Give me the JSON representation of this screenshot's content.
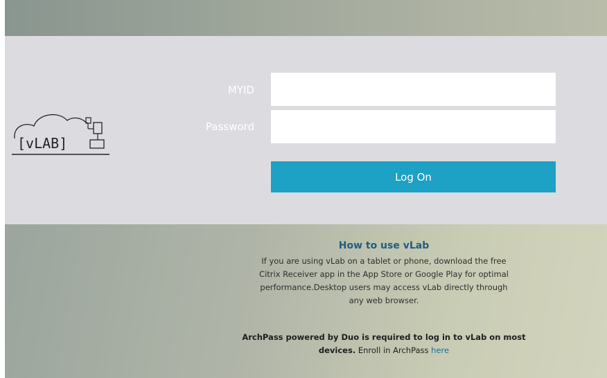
{
  "login": {
    "myid_label": "MYID",
    "myid_value": "",
    "password_label": "Password",
    "password_value": "",
    "logon_label": "Log On"
  },
  "logo": {
    "text": "[vLAB]",
    "icon": "cloud-computer-icon"
  },
  "info": {
    "title": "How to use vLab",
    "body": "If you are using vLab on a tablet or phone, download the free Citrix Receiver app in the App Store or Google Play for optimal performance.Desktop users may access vLab directly through any web browser.",
    "duo_bold": "ArchPass powered by Duo is required to log in to vLab on most devices.",
    "enroll_text": " Enroll in ArchPass ",
    "link_text": "here"
  },
  "colors": {
    "button": "#1da1c4",
    "panel": "#dcdce0",
    "title": "#1f5d82",
    "link": "#1f6fa0"
  }
}
